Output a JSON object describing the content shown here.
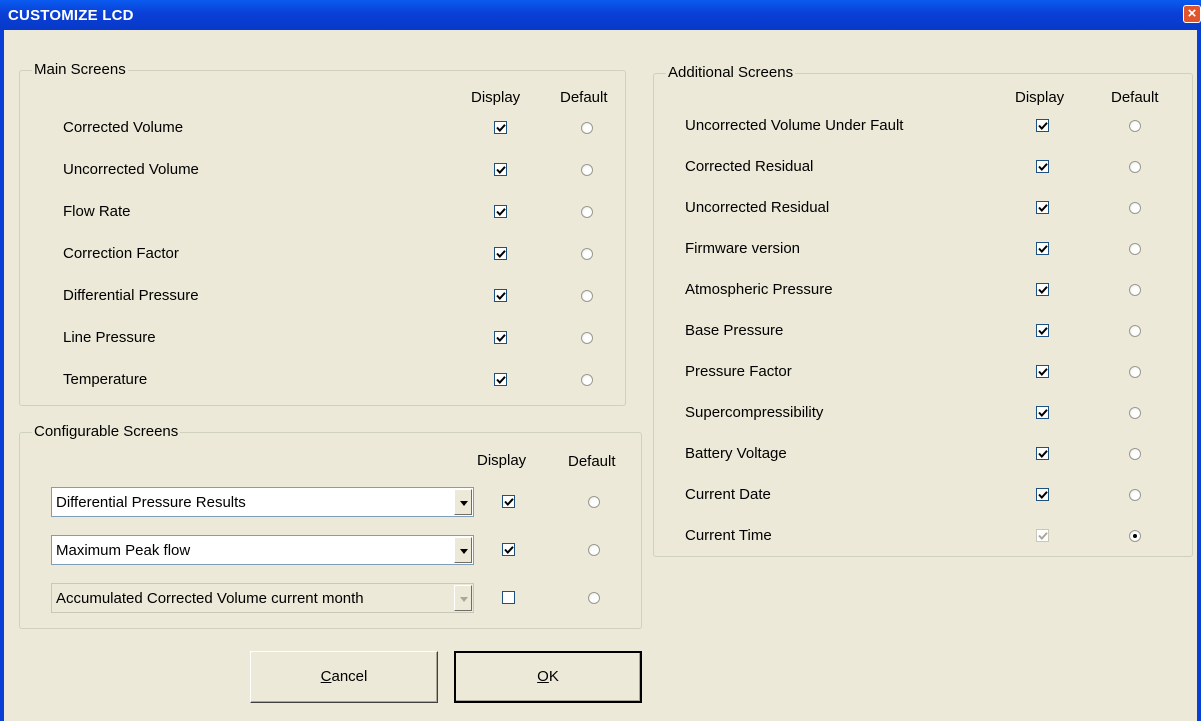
{
  "window": {
    "title": "CUSTOMIZE LCD",
    "close_glyph": "×"
  },
  "main_screens": {
    "legend": "Main Screens",
    "display_header": "Display",
    "default_header": "Default",
    "rows": [
      {
        "label": "Corrected Volume",
        "display": true,
        "default": false
      },
      {
        "label": "Uncorrected Volume",
        "display": true,
        "default": false
      },
      {
        "label": "Flow Rate",
        "display": true,
        "default": false
      },
      {
        "label": "Correction Factor",
        "display": true,
        "default": false
      },
      {
        "label": "Differential Pressure",
        "display": true,
        "default": false
      },
      {
        "label": "Line Pressure",
        "display": true,
        "default": false
      },
      {
        "label": "Temperature",
        "display": true,
        "default": false
      }
    ]
  },
  "configurable_screens": {
    "legend": "Configurable Screens",
    "display_header": "Display",
    "default_header": "Default",
    "rows": [
      {
        "value": "Differential Pressure Results",
        "display": true,
        "default": false,
        "enabled": true
      },
      {
        "value": "Maximum Peak flow",
        "display": true,
        "default": false,
        "enabled": true
      },
      {
        "value": "Accumulated Corrected Volume current month",
        "display": false,
        "default": false,
        "enabled": false
      }
    ]
  },
  "additional_screens": {
    "legend": "Additional Screens",
    "display_header": "Display",
    "default_header": "Default",
    "rows": [
      {
        "label": "Uncorrected Volume Under Fault",
        "display": true,
        "default": false
      },
      {
        "label": "Corrected Residual",
        "display": true,
        "default": false
      },
      {
        "label": "Uncorrected Residual",
        "display": true,
        "default": false
      },
      {
        "label": "Firmware version",
        "display": true,
        "default": false
      },
      {
        "label": "Atmospheric Pressure",
        "display": true,
        "default": false
      },
      {
        "label": "Base Pressure",
        "display": true,
        "default": false
      },
      {
        "label": "Pressure Factor",
        "display": true,
        "default": false
      },
      {
        "label": "Supercompressibility",
        "display": true,
        "default": false
      },
      {
        "label": "Battery Voltage",
        "display": true,
        "default": false
      },
      {
        "label": "Current Date",
        "display": true,
        "default": false
      },
      {
        "label": "Current Time",
        "display": true,
        "default": true,
        "display_disabled": true
      }
    ]
  },
  "buttons": {
    "cancel": {
      "mnemonic": "C",
      "rest": "ancel"
    },
    "ok": {
      "mnemonic": "O",
      "rest": "K"
    }
  },
  "colors": {
    "titlebar": "#0a3fd6",
    "dialog_bg": "#ece9d8",
    "close_button": "#e1542c"
  },
  "icons": {
    "checkmark": "check-icon",
    "dropdown": "chevron-down-icon",
    "close": "close-icon"
  }
}
